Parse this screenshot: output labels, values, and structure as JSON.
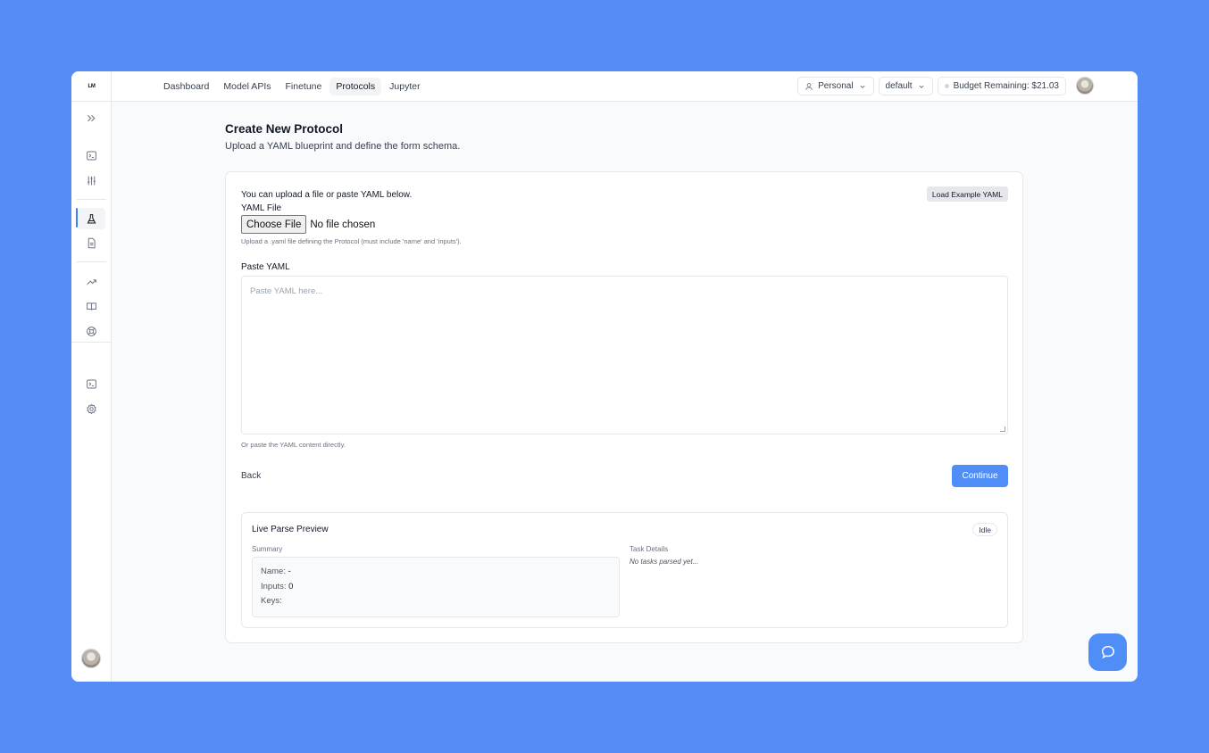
{
  "app": {
    "logo_text": "LM"
  },
  "nav": {
    "items": [
      {
        "label": "Dashboard",
        "active": false
      },
      {
        "label": "Model APIs",
        "active": false
      },
      {
        "label": "Finetune",
        "active": false
      },
      {
        "label": "Protocols",
        "active": true
      },
      {
        "label": "Jupyter",
        "active": false
      }
    ]
  },
  "topbar": {
    "account": "Personal",
    "project": "default",
    "budget": "Budget Remaining: $21.03"
  },
  "sidebar": {
    "icons": [
      "expand-icon",
      "terminal-icon",
      "sliders-icon",
      "flask-icon",
      "document-icon",
      "trending-icon",
      "book-icon",
      "lifebuoy-icon",
      "console-icon",
      "settings-icon"
    ],
    "active": "flask-icon"
  },
  "page": {
    "title": "Create New Protocol",
    "subtitle": "Upload a YAML blueprint and define the form schema."
  },
  "form": {
    "intro": "You can upload a file or paste YAML below.",
    "load_example": "Load Example YAML",
    "yaml_file_label": "YAML File",
    "choose_file": "Choose File",
    "no_file": "No file chosen",
    "file_hint": "Upload a .yaml file defining the Protocol (must include 'name' and 'inputs').",
    "paste_label": "Paste YAML",
    "paste_placeholder": "Paste YAML here...",
    "paste_hint": "Or paste the YAML content directly.",
    "back": "Back",
    "continue": "Continue"
  },
  "preview": {
    "title": "Live Parse Preview",
    "status": "Idle",
    "summary_label": "Summary",
    "name_label": "Name:",
    "name_value": "-",
    "inputs_label": "Inputs:",
    "inputs_value": "0",
    "keys_label": "Keys:",
    "keys_value": "",
    "task_label": "Task Details",
    "task_empty": "No tasks parsed yet..."
  },
  "colors": {
    "background": "#558cf6",
    "accent": "#4f8ef7"
  }
}
